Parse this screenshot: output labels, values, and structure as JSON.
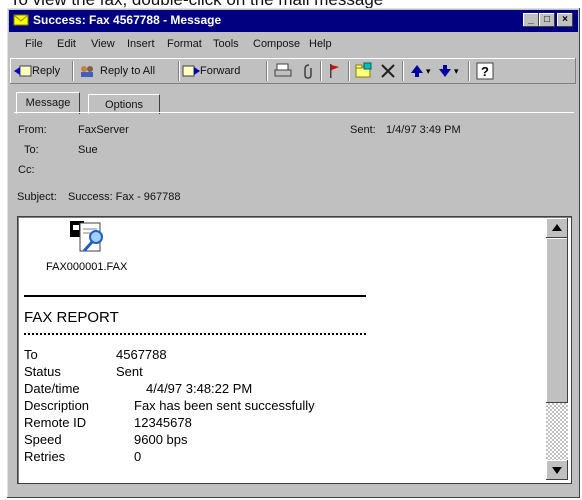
{
  "caption": "To view the fax, double-click on the mail message",
  "window": {
    "title": "Success: Fax 4567788 - Message",
    "controls": {
      "minimize": "_",
      "maximize": "□",
      "close": "×"
    }
  },
  "menu": [
    "File",
    "Edit",
    "View",
    "Insert",
    "Format",
    "Tools",
    "Compose",
    "Help"
  ],
  "toolbar": {
    "reply": "Reply",
    "reply_all": "Reply to All",
    "forward": "Forward"
  },
  "tabs": [
    "Message",
    "Options"
  ],
  "header": {
    "from_label": "From:",
    "from_value": "FaxServer",
    "sent_label": "Sent:",
    "sent_value": "1/4/97 3:49 PM",
    "to_label": "To:",
    "to_value": "Sue",
    "cc_label": "Cc:",
    "cc_value": "",
    "subject_label": "Subject:",
    "subject_value": "Success: Fax - 967788"
  },
  "attachment": {
    "name": "FAX000001.FAX"
  },
  "report": {
    "title": "FAX REPORT",
    "rows": [
      {
        "label": "To",
        "value": "4567788"
      },
      {
        "label": "Status",
        "value": "Sent"
      },
      {
        "label": "Date/time",
        "value": "4/4/97 3:48:22 PM"
      },
      {
        "label": "Description",
        "value": "Fax has been sent successfully"
      },
      {
        "label": "Remote ID",
        "value": "12345678"
      },
      {
        "label": "Speed",
        "value": "9600 bps"
      },
      {
        "label": "Retries",
        "value": "0"
      }
    ]
  },
  "colors": {
    "title_bar": "#000080",
    "chrome": "#c0c0c0",
    "text": "#111111"
  }
}
